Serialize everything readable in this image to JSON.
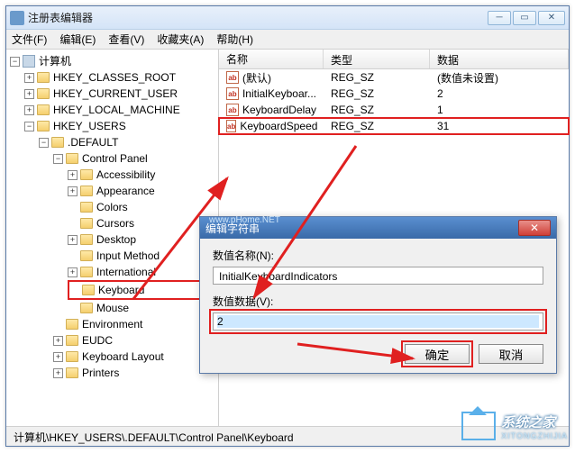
{
  "window": {
    "title": "注册表编辑器"
  },
  "menu": {
    "file": "文件(F)",
    "edit": "编辑(E)",
    "view": "查看(V)",
    "fav": "收藏夹(A)",
    "help": "帮助(H)"
  },
  "tree": {
    "root": "计算机",
    "hkcr": "HKEY_CLASSES_ROOT",
    "hkcu": "HKEY_CURRENT_USER",
    "hklm": "HKEY_LOCAL_MACHINE",
    "hku": "HKEY_USERS",
    "default": ".DEFAULT",
    "cp": "Control Panel",
    "accessibility": "Accessibility",
    "appearance": "Appearance",
    "colors": "Colors",
    "cursors": "Cursors",
    "desktop": "Desktop",
    "inputmethod": "Input Method",
    "international": "International",
    "keyboard": "Keyboard",
    "mouse": "Mouse",
    "environment": "Environment",
    "eudc": "EUDC",
    "kblayout": "Keyboard Layout",
    "printers": "Printers"
  },
  "list": {
    "hdr_name": "名称",
    "hdr_type": "类型",
    "hdr_data": "数据",
    "rows": [
      {
        "name": "(默认)",
        "type": "REG_SZ",
        "data": "(数值未设置)"
      },
      {
        "name": "InitialKeyboar...",
        "type": "REG_SZ",
        "data": "2"
      },
      {
        "name": "KeyboardDelay",
        "type": "REG_SZ",
        "data": "1"
      },
      {
        "name": "KeyboardSpeed",
        "type": "REG_SZ",
        "data": "31"
      }
    ]
  },
  "dialog": {
    "title": "编辑字符串",
    "name_label": "数值名称(N):",
    "name_value": "InitialKeyboardIndicators",
    "data_label": "数值数据(V):",
    "data_value": "2",
    "ok": "确定",
    "cancel": "取消",
    "url_overlay": "www.pHome.NET"
  },
  "status": {
    "path": "计算机\\HKEY_USERS\\.DEFAULT\\Control Panel\\Keyboard"
  },
  "watermark": {
    "text": "系统之家",
    "sub": "XITONGZHIJIA"
  }
}
